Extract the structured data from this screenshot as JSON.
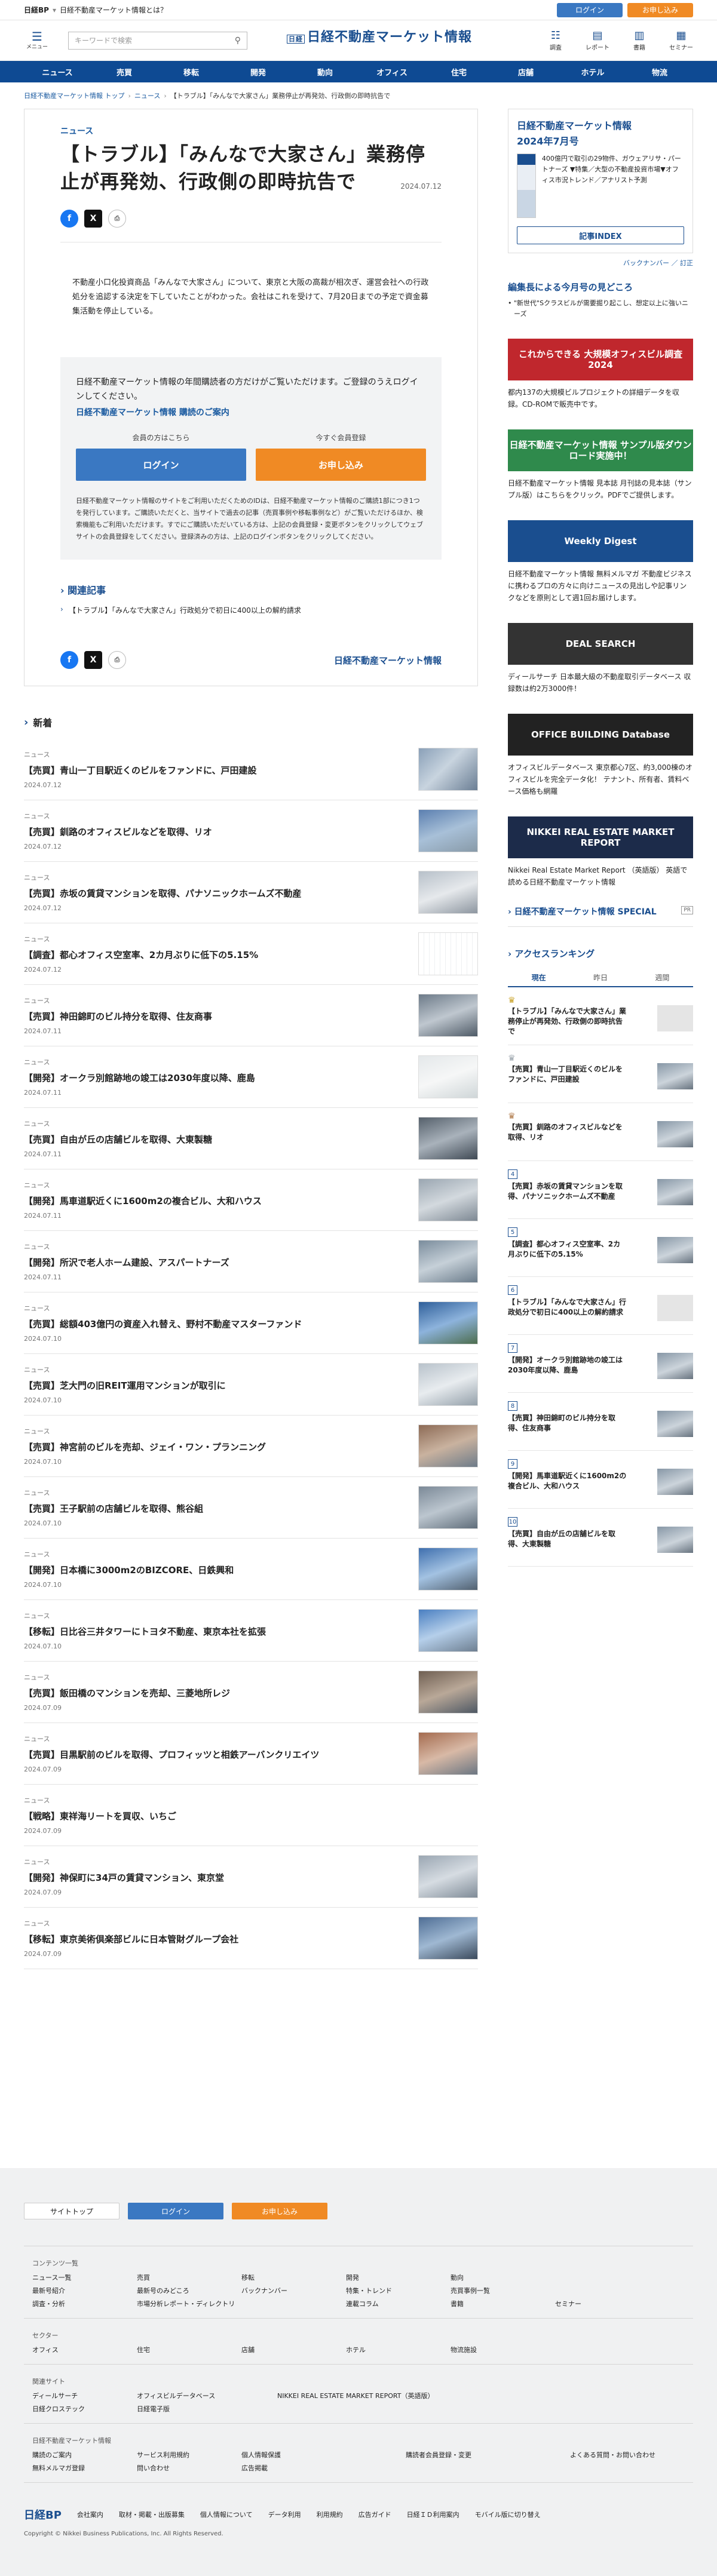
{
  "topbar": {
    "title": "日経不動産マーケット情報とは？",
    "login": "ログイン",
    "apply": "お申し込み"
  },
  "header": {
    "menu": "メニュー",
    "search_placeholder": "キーワードで検索",
    "logo": "日経不動産マーケット情報",
    "icons": [
      {
        "g": "☷",
        "label": "調査"
      },
      {
        "g": "▤",
        "label": "レポート"
      },
      {
        "g": "▥",
        "label": "書籍"
      },
      {
        "g": "▦",
        "label": "セミナー"
      }
    ]
  },
  "nav": [
    "ニュース",
    "売買",
    "移転",
    "開発",
    "動向",
    "オフィス",
    "住宅",
    "店舗",
    "ホテル",
    "物流"
  ],
  "breadcrumb": [
    "日経不動産マーケット情報 トップ",
    "ニュース",
    "【トラブル】「みんなで大家さん」業務停止が再発効、行政側の即時抗告で"
  ],
  "article": {
    "category": "ニュース",
    "title": "【トラブル】「みんなで大家さん」業務停止が再発効、行政側の即時抗告で",
    "date": "2024.07.12",
    "lead": "不動産小口化投資商品「みんなで大家さん」について、東京と大阪の高裁が相次ぎ、運営会社への行政処分を追認する決定を下していたことがわかった。会社はこれを受けて、7月20日までの予定で資金募集活動を停止している。"
  },
  "gate": {
    "text": "日経不動産マーケット情報の年間購読者の方だけがご覧いただけます。ご登録のうえログインしてください。",
    "link": "日経不動産マーケット情報 購読のご案内",
    "member": "会員の方はこちら",
    "newreg": "今すぐ会員登録",
    "login": "ログイン",
    "apply": "お申し込み",
    "note": "日経不動産マーケット情報のサイトをご利用いただくためのIDは、日経不動産マーケット情報のご購読1部につき1つを発行しています。ご購読いただくと、当サイトで過去の記事（売買事例や移転事例など）がご覧いただけるほか、検索機能もご利用いただけます。すでにご購読いただいている方は、上記の会員登録・変更ボタンをクリックしてウェブサイトの会員登録をしてください。登録済みの方は、上記のログインボタンをクリックしてください。"
  },
  "related": {
    "title": "関連記事",
    "items": [
      "【トラブル】「みんなで大家さん」行政処分で初日に400以上の解約請求"
    ]
  },
  "share": {
    "fb": "f",
    "x": "X",
    "print": "⎙"
  },
  "footer_logo": "日経不動産マーケット情報",
  "newlist": {
    "title": "新着",
    "items": [
      {
        "c": "ニュース",
        "t": "【売買】青山一丁目駅近くのビルをファンドに、戸田建設",
        "d": "2024.07.12"
      },
      {
        "c": "ニュース",
        "t": "【売買】釧路のオフィスビルなどを取得、リオ",
        "d": "2024.07.12"
      },
      {
        "c": "ニュース",
        "t": "【売買】赤坂の賃貸マンションを取得、パナソニックホームズ不動産",
        "d": "2024.07.12"
      },
      {
        "c": "ニュース",
        "t": "【調査】都心オフィス空室率、2カ月ぶりに低下の5.15%",
        "d": "2024.07.12"
      },
      {
        "c": "ニュース",
        "t": "【売買】神田錦町のビル持分を取得、住友商事",
        "d": "2024.07.11"
      },
      {
        "c": "ニュース",
        "t": "【開発】オークラ別館跡地の竣工は2030年度以降、鹿島",
        "d": "2024.07.11"
      },
      {
        "c": "ニュース",
        "t": "【売買】自由が丘の店舗ビルを取得、大東製糖",
        "d": "2024.07.11"
      },
      {
        "c": "ニュース",
        "t": "【開発】馬車道駅近くに1600m2の複合ビル、大和ハウス",
        "d": "2024.07.11"
      },
      {
        "c": "ニュース",
        "t": "【開発】所沢で老人ホーム建設、アスパートナーズ",
        "d": "2024.07.11"
      },
      {
        "c": "ニュース",
        "t": "【売買】総額403億円の資産入れ替え、野村不動産マスターファンド",
        "d": "2024.07.10"
      },
      {
        "c": "ニュース",
        "t": "【売買】芝大門の旧REIT運用マンションが取引に",
        "d": "2024.07.10"
      },
      {
        "c": "ニュース",
        "t": "【売買】神宮前のビルを売却、ジェイ・ワン・プランニング",
        "d": "2024.07.10"
      },
      {
        "c": "ニュース",
        "t": "【売買】王子駅前の店舗ビルを取得、熊谷組",
        "d": "2024.07.10"
      },
      {
        "c": "ニュース",
        "t": "【開発】日本橋に3000m2のBIZCORE、日鉄興和",
        "d": "2024.07.10"
      },
      {
        "c": "ニュース",
        "t": "【移転】日比谷三井タワーにトヨタ不動産、東京本社を拡張",
        "d": "2024.07.10"
      },
      {
        "c": "ニュース",
        "t": "【売買】飯田橋のマンションを売却、三菱地所レジ",
        "d": "2024.07.09"
      },
      {
        "c": "ニュース",
        "t": "【売買】目黒駅前のビルを取得、プロフィッツと相鉄アーバンクリエイツ",
        "d": "2024.07.09"
      },
      {
        "c": "ニュース",
        "t": "【戦略】東祥海リートを買収、いちご",
        "d": "2024.07.09"
      },
      {
        "c": "ニュース",
        "t": "【開発】神保町に34戸の賃貸マンション、東京堂",
        "d": "2024.07.09"
      },
      {
        "c": "ニュース",
        "t": "【移転】東京美術倶楽部ビルに日本管財グループ会社",
        "d": "2024.07.09"
      }
    ]
  },
  "side": {
    "mag_title": "日経不動産マーケット情報",
    "mag_issue": "2024年7月号",
    "mag_desc": "400億円で取引の29物件、ガウェアリサ・パートナーズ ▼特集／大型の不動産投資市場▼オフィス市況トレンド／アナリスト予測",
    "index": "記事INDEX",
    "backnumber": "バックナンバー ／ 訂正",
    "feat": "編集長による今月号の見どころ",
    "feat_item": "\"新世代\"Sクラスビルが需要掘り起こし、想定以上に強いニーズ",
    "ads": [
      {
        "b": "これからできる 大規模オフィスビル調査2024",
        "t": "都内137の大規模ビルプロジェクトの詳細データを収録。CD-ROMで販売中です。",
        "c": "#c0272d"
      },
      {
        "b": "日経不動産マーケット情報 サンプル版ダウンロード実施中！",
        "t": "日経不動産マーケット情報 見本誌 月刊誌の見本誌（サンプル版）はこちらをクリック。PDFでご提供します。",
        "c": "#2f8a4c"
      },
      {
        "b": "Weekly Digest",
        "t": "日経不動産マーケット情報 無料メルマガ 不動産ビジネスに携わるプロの方々に向けニュースの見出しや記事リンクなどを原則として週1回お届けします。",
        "c": "#1a4e8f"
      },
      {
        "b": "DEAL SEARCH",
        "t": "ディールサーチ 日本最大級の不動産取引データベース 収録数は約2万3000件！",
        "c": "#333"
      },
      {
        "b": "OFFICE BUILDING Database",
        "t": "オフィスビルデータベース 東京都心7区、約3,000棟のオフィスビルを完全データ化！ テナント、所有者、賃料ベース価格も網羅",
        "c": "#222"
      },
      {
        "b": "NIKKEI REAL ESTATE MARKET REPORT",
        "t": "Nikkei Real Estate Market Report （英語版） 英語で読める日経不動産マーケット情報",
        "c": "#1c2b4a"
      }
    ],
    "special": "日経不動産マーケット情報 SPECIAL",
    "pr": "PR",
    "rank_title": "アクセスランキング",
    "tabs": [
      "現在",
      "昨日",
      "週間"
    ],
    "rank": [
      {
        "t": "【トラブル】「みんなで大家さん」業務停止が再発効、行政側の即時抗告で"
      },
      {
        "t": "【売買】青山一丁目駅近くのビルをファンドに、戸田建設"
      },
      {
        "t": "【売買】釧路のオフィスビルなどを取得、リオ"
      },
      {
        "t": "【売買】赤坂の賃貸マンションを取得、パナソニックホームズ不動産"
      },
      {
        "t": "【調査】都心オフィス空室率、2カ月ぶりに低下の5.15%"
      },
      {
        "t": "【トラブル】「みんなで大家さん」行政処分で初日に400以上の解約請求"
      },
      {
        "t": "【開発】オークラ別館跡地の竣工は2030年度以降、鹿島"
      },
      {
        "t": "【売買】神田錦町のビル持分を取得、住友商事"
      },
      {
        "t": "【開発】馬車道駅近くに1600m2の複合ビル、大和ハウス"
      },
      {
        "t": "【売買】自由が丘の店舗ビルを取得、大東製糖"
      }
    ]
  },
  "footer": {
    "top": "サイトトップ",
    "login": "ログイン",
    "apply": "お申し込み",
    "groups": [
      {
        "h": "コンテンツ一覧",
        "items": [
          "ニュース一覧",
          "売買",
          "移転",
          "開発",
          "動向",
          "",
          "最新号紹介",
          "最新号のみどころ",
          "バックナンバー",
          "特集・トレンド",
          "売買事例一覧",
          "",
          "調査・分析",
          "市場分析レポート・ディレクトリ",
          "",
          "連載コラム",
          "書籍",
          "セミナー"
        ]
      },
      {
        "h": "セクター",
        "items": [
          "オフィス",
          "住宅",
          "店舗",
          "ホテル",
          "物流施設"
        ]
      },
      {
        "h": "関連サイト",
        "items": [
          "ディールサーチ",
          "オフィスビルデータベース",
          "NIKKEI REAL ESTATE MARKET REPORT（英語版）",
          "",
          "日経クロステック",
          "日経電子版"
        ]
      },
      {
        "h": "日経不動産マーケット情報",
        "items": [
          "購読のご案内",
          "サービス利用規約",
          "個人情報保護",
          "購読者会員登録・変更",
          "よくある質問・お問い合わせ",
          "無料メルマガ登録",
          "問い合わせ",
          "広告掲載"
        ]
      }
    ],
    "bottom": [
      "日経BP",
      "会社案内",
      "取材・掲載・出版募集",
      "個人情報について",
      "データ利用",
      "利用規約",
      "広告ガイド",
      "日経ＩＤ利用案内",
      "モバイル版に切り替え"
    ],
    "copyright": "Copyright © Nikkei Business Publications, Inc. All Rights Reserved."
  }
}
